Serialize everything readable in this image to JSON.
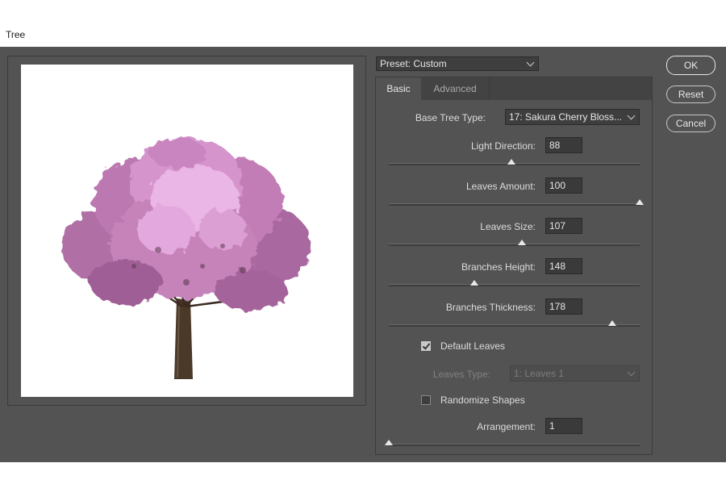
{
  "window": {
    "title": "Tree"
  },
  "preset": {
    "label": "Preset: Custom"
  },
  "tabs": [
    {
      "label": "Basic",
      "active": true
    },
    {
      "label": "Advanced",
      "active": false
    }
  ],
  "basic": {
    "base_tree_type": {
      "label": "Base Tree Type:",
      "value": "17: Sakura Cherry Bloss..."
    },
    "sliders": [
      {
        "label": "Light Direction:",
        "value": "88",
        "fraction": 0.49
      },
      {
        "label": "Leaves Amount:",
        "value": "100",
        "fraction": 1.0
      },
      {
        "label": "Leaves Size:",
        "value": "107",
        "fraction": 0.53
      },
      {
        "label": "Branches Height:",
        "value": "148",
        "fraction": 0.34
      },
      {
        "label": "Branches Thickness:",
        "value": "178",
        "fraction": 0.89
      }
    ],
    "default_leaves": {
      "label": "Default Leaves",
      "checked": true
    },
    "leaves_type": {
      "label": "Leaves Type:",
      "value": "1: Leaves 1",
      "disabled": true
    },
    "randomize_shapes": {
      "label": "Randomize Shapes",
      "checked": false
    },
    "arrangement": {
      "label": "Arrangement:",
      "value": "1",
      "fraction": 0.0
    }
  },
  "buttons": {
    "ok": "OK",
    "reset": "Reset",
    "cancel": "Cancel"
  },
  "colors": {
    "blossom": "#c27bb6",
    "blossom_light": "#eab6e6",
    "trunk": "#4a3828",
    "dialog_bg": "#535353"
  },
  "preview": {
    "content": "sakura-tree-preview"
  }
}
